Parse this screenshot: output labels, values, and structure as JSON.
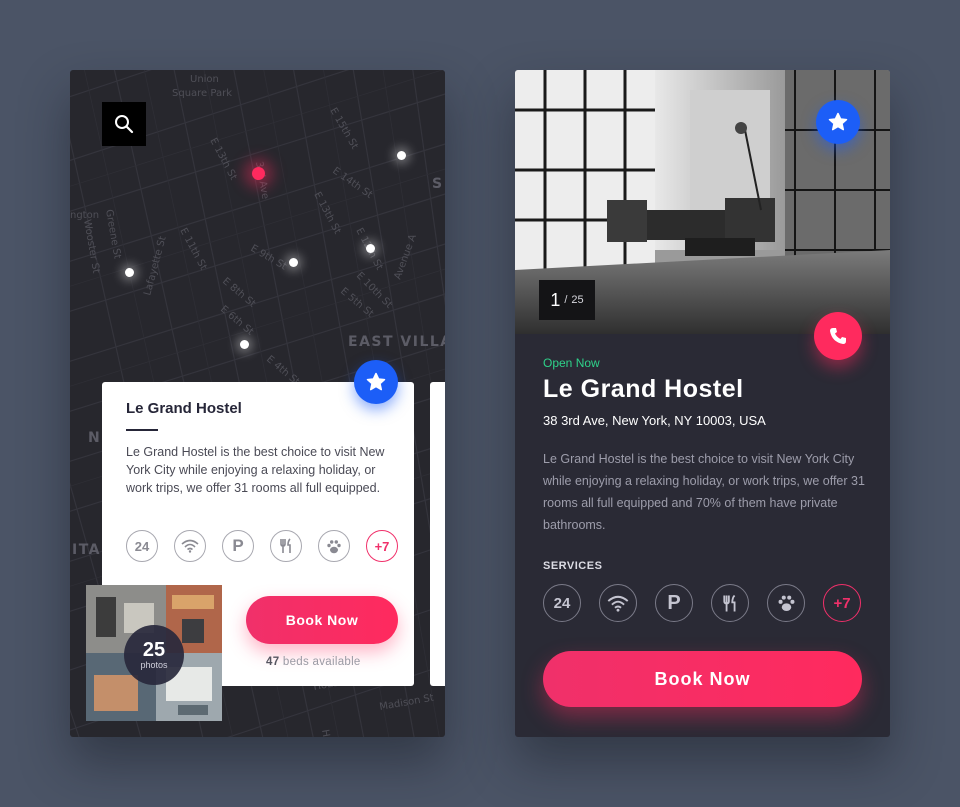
{
  "map": {
    "street_labels": [
      "Union",
      "Square Park",
      "E 15th St",
      "E 14th St",
      "E 13th St",
      "E 12th St",
      "E 11th St",
      "E 10th St",
      "E 9th St",
      "E 8th St",
      "E 7th St",
      "E 5th St",
      "E 6th St",
      "E 4th St",
      "Broadway",
      "3rd Ave",
      "Lafayette St",
      "Greene St",
      "Wooster St",
      "Avenue A",
      "Houston St",
      "Madison St",
      "Henry St"
    ],
    "area_labels": [
      "EAST VILLAGE",
      "ngton",
      "Pl"
    ],
    "edge_labels": [
      "S",
      "N",
      "ITA"
    ]
  },
  "map_card": {
    "title": "Le Grand Hostel",
    "description": "Le Grand Hostel is the best choice to visit New York City while enjoying a relaxing holiday, or work trips, we offer 31 rooms all full equipped.",
    "services": [
      "24",
      "wifi-icon",
      "P",
      "restaurant-icon",
      "pet-icon",
      "+7"
    ],
    "photos_count": "25",
    "photos_label": "photos",
    "book_label": "Book Now",
    "beds_count": "47",
    "beds_label": "beds available"
  },
  "detail": {
    "counter_current": "1",
    "counter_separator": "/",
    "counter_total": "25",
    "status": "Open Now",
    "title": "Le Grand Hostel",
    "address": "38 3rd Ave, New York, NY 10003, USA",
    "description": "Le Grand Hostel is the best choice to visit New York City while enjoying a relaxing holiday, or work trips, we offer 31 rooms all full equipped and 70% of them have private bathrooms.",
    "services_label": "SERVICES",
    "services": [
      "24",
      "wifi-icon",
      "P",
      "restaurant-icon",
      "pet-icon",
      "+7"
    ],
    "book_label": "Book Now"
  },
  "colors": {
    "background": "#4b5466",
    "map_bg": "#27272d",
    "accent_pink": "#ff2a5e",
    "accent_blue": "#1c5ef7",
    "open_green": "#2ed38a",
    "detail_bg": "#2a2a35"
  }
}
